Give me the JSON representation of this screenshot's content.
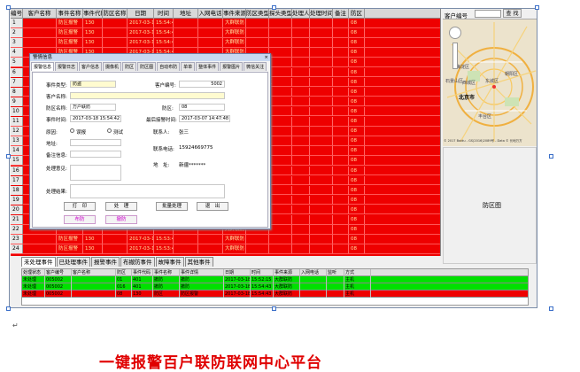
{
  "grid": {
    "headers": [
      "编号",
      "客户名称",
      "事件名称",
      "事件代码",
      "防区名称",
      "日期",
      "时间",
      "地址",
      "入网电话",
      "事件来源",
      "防区类型",
      "探头类型",
      "处理人",
      "处理时间",
      "备注",
      "防区"
    ],
    "rows": [
      {
        "n": "1",
        "name": "",
        "event": "防区报警",
        "code": "130",
        "zone_name": "",
        "date": "2017-03-16",
        "time": "15:54:42",
        "src": "大群联防",
        "dz": "08"
      },
      {
        "n": "2",
        "name": "",
        "event": "防区报警",
        "code": "130",
        "zone_name": "",
        "date": "2017-03-16",
        "time": "15:54:43",
        "src": "大群联防",
        "dz": "08"
      },
      {
        "n": "3",
        "name": "",
        "event": "防区报警",
        "code": "130",
        "zone_name": "",
        "date": "2017-03-16",
        "time": "15:54:44",
        "src": "大群联防",
        "dz": "08"
      },
      {
        "n": "4",
        "name": "",
        "event": "防区报警",
        "code": "130",
        "zone_name": "",
        "date": "2017-03-16",
        "time": "15:54:45",
        "src": "大群联防",
        "dz": "08"
      },
      {
        "n": "5",
        "name": "",
        "event": "",
        "code": "",
        "zone_name": "",
        "date": "",
        "time": "",
        "src": "大群联防",
        "dz": "08"
      },
      {
        "n": "6",
        "name": "",
        "event": "",
        "code": "",
        "zone_name": "",
        "date": "",
        "time": "",
        "src": "大群联防",
        "dz": "08"
      },
      {
        "n": "7",
        "name": "",
        "event": "",
        "code": "",
        "zone_name": "",
        "date": "",
        "time": "",
        "src": "大群联防/24小时防区",
        "dz": "08"
      },
      {
        "n": "8",
        "name": "",
        "event": "",
        "code": "",
        "zone_name": "",
        "date": "",
        "time": "",
        "src": "大群联防",
        "dz": "08"
      },
      {
        "n": "9",
        "name": "",
        "event": "",
        "code": "",
        "zone_name": "",
        "date": "",
        "time": "",
        "src": "大群联防",
        "dz": "08"
      },
      {
        "n": "10",
        "name": "",
        "event": "",
        "code": "",
        "zone_name": "",
        "date": "",
        "time": "",
        "src": "大群联防",
        "dz": "08"
      },
      {
        "n": "11",
        "name": "",
        "event": "",
        "code": "",
        "zone_name": "",
        "date": "",
        "time": "",
        "src": "大群联防",
        "dz": "08"
      },
      {
        "n": "12",
        "name": "",
        "event": "",
        "code": "",
        "zone_name": "",
        "date": "",
        "time": "",
        "src": "大群联防",
        "dz": "08"
      },
      {
        "n": "13",
        "name": "",
        "event": "",
        "code": "",
        "zone_name": "",
        "date": "",
        "time": "",
        "src": "大群联防",
        "dz": "08"
      },
      {
        "n": "14",
        "name": "",
        "event": "",
        "code": "",
        "zone_name": "",
        "date": "",
        "time": "",
        "src": "大群联防",
        "dz": "08"
      },
      {
        "n": "15",
        "name": "",
        "event": "",
        "code": "",
        "zone_name": "",
        "date": "",
        "time": "",
        "src": "大群联防",
        "dz": "08"
      },
      {
        "n": "16",
        "name": "",
        "event": "",
        "code": "",
        "zone_name": "",
        "date": "",
        "time": "",
        "src": "大群联防",
        "dz": "08"
      },
      {
        "n": "17",
        "name": "",
        "event": "",
        "code": "",
        "zone_name": "",
        "date": "",
        "time": "",
        "src": "大群联防",
        "dz": "08"
      },
      {
        "n": "18",
        "name": "",
        "event": "",
        "code": "",
        "zone_name": "",
        "date": "",
        "time": "",
        "src": "大群联防",
        "dz": "08"
      },
      {
        "n": "19",
        "name": "",
        "event": "",
        "code": "",
        "zone_name": "",
        "date": "",
        "time": "",
        "src": "大群联防",
        "dz": "08"
      },
      {
        "n": "20",
        "name": "",
        "event": "",
        "code": "",
        "zone_name": "",
        "date": "",
        "time": "",
        "src": "大群联防",
        "dz": "08"
      },
      {
        "n": "21",
        "name": "",
        "event": "",
        "code": "",
        "zone_name": "",
        "date": "",
        "time": "",
        "src": "大群联防",
        "dz": "08"
      },
      {
        "n": "22",
        "name": "",
        "event": "",
        "code": "",
        "zone_name": "",
        "date": "",
        "time": "",
        "src": "大群联防",
        "dz": "08"
      },
      {
        "n": "23",
        "name": "",
        "event": "防区报警",
        "code": "130",
        "zone_name": "",
        "date": "2017-03-18",
        "time": "15:53:43",
        "src": "大群联防",
        "dz": "08"
      },
      {
        "n": "24",
        "name": "",
        "event": "防区报警",
        "code": "130",
        "zone_name": "",
        "date": "2017-03-18",
        "time": "15:53:43",
        "src": "大群联防",
        "dz": "08"
      }
    ]
  },
  "dialog": {
    "title": "警情信息",
    "close": "×",
    "tabs": [
      "报警信息",
      "报警日志",
      "客户信息",
      "摄像机",
      "防区",
      "防区图",
      "自动布防",
      "单单",
      "整体事件",
      "报警图片",
      "微信关注"
    ],
    "labels": {
      "event_type": "事件类型:",
      "customer_no": "客户编号:",
      "customer_name": "客户名称:",
      "zone_name": "防区名称:",
      "zone": "防区:",
      "event_time": "事件时间:",
      "latest_time": "最后接警时间:",
      "cause": "原因:",
      "contact": "联系人:",
      "address": "地址:",
      "phone": "联系电话:",
      "remark": "备注信息:",
      "addr2": "地　址:",
      "opinion": "处理意见:",
      "result": "处理结果:"
    },
    "values": {
      "event_type": "防盗",
      "customer_no": "5002",
      "zone_name": "万户联防",
      "zone": "08",
      "event_time": "2017-03-18 15:54:42",
      "latest_time": "2017-03-07 14:47:48",
      "contact": "张三",
      "phone": "15924669775",
      "addr2": "新疆*******"
    },
    "radios": [
      "误报",
      "测试"
    ],
    "buttons": [
      "打　印",
      "处　理",
      "批量处理",
      "退　出"
    ],
    "arm_buttons": [
      "布防",
      "撤防"
    ]
  },
  "map": {
    "label": "客户编号",
    "search": "查 找",
    "city": "北京市",
    "credit": "© 2017 Baidu - GS(2016)2089号 - Data © 长地万方",
    "places": [
      "海淀区",
      "东城区",
      "西城区",
      "朝阳区",
      "丰台区",
      "石景山区"
    ]
  },
  "guard_panel": {
    "label": "防区图"
  },
  "event_tabs": [
    "未处理事件",
    "已处理事件",
    "报警事件",
    "布撤防事件",
    "故障事件",
    "其他事件"
  ],
  "bottom": {
    "headers": [
      "处理状态",
      "客户编号",
      "客户名称",
      "防区",
      "事件代码",
      "事件名称",
      "事件详情",
      "日期",
      "时间",
      "事件来源",
      "入网电话",
      "监听",
      "方式"
    ],
    "rows": [
      {
        "status": "未处理",
        "no": "005002",
        "name": "",
        "zone": "01",
        "code": "401",
        "ename": "撤防",
        "detail": "撤防",
        "date": "2017-03-18",
        "time": "15:52:15",
        "src": "大群联防",
        "phone": "",
        "listen": "",
        "mode": "主机",
        "color": "#00e000"
      },
      {
        "status": "未处理",
        "no": "005002",
        "name": "",
        "zone": "016",
        "code": "401",
        "ename": "撤防",
        "detail": "撤防",
        "date": "2017-03-18",
        "time": "15:54:43",
        "src": "大群联防",
        "phone": "",
        "listen": "",
        "mode": "主机",
        "color": "#00e000"
      },
      {
        "status": "未处理",
        "no": "005002",
        "name": "",
        "zone": "08",
        "code": "130",
        "ename": "防区",
        "detail": "防区报警",
        "date": "2017-03-18",
        "time": "15:54:43",
        "src": "大群联防",
        "phone": "",
        "listen": "",
        "mode": "主机",
        "color": "#ee0000"
      }
    ]
  },
  "caption": "一键报警百户联防联网中心平台"
}
